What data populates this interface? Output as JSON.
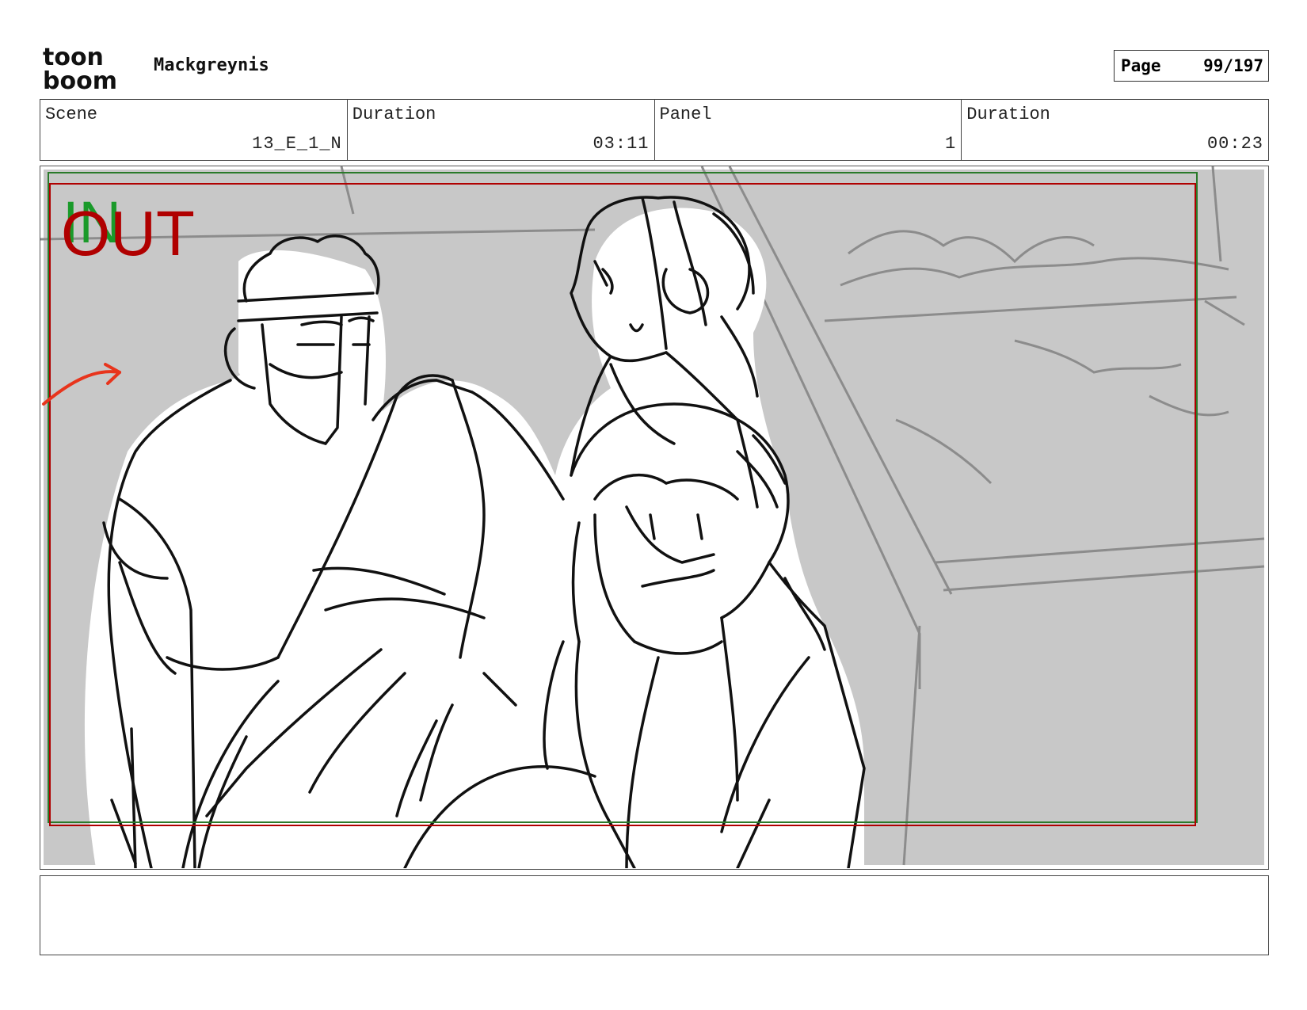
{
  "header": {
    "logo_top": "toon",
    "logo_bottom": "boom",
    "project_name": "Mackgreynis",
    "page_label": "Page",
    "page_number": "99/197"
  },
  "info": {
    "scene_label": "Scene",
    "scene_value": "13_E_1_N",
    "scene_duration_label": "Duration",
    "scene_duration_value": "03:11",
    "panel_label": "Panel",
    "panel_value": "1",
    "panel_duration_label": "Duration",
    "panel_duration_value": "00:23"
  },
  "panel": {
    "in_marker": "IN",
    "out_marker": "OUT",
    "colors": {
      "background_gray": "#c8c8c8",
      "safe_frame_green": "#2a7a2a",
      "camera_frame_red": "#b00000",
      "arrow_red": "#e8341c"
    }
  },
  "notes": {
    "text": ""
  }
}
